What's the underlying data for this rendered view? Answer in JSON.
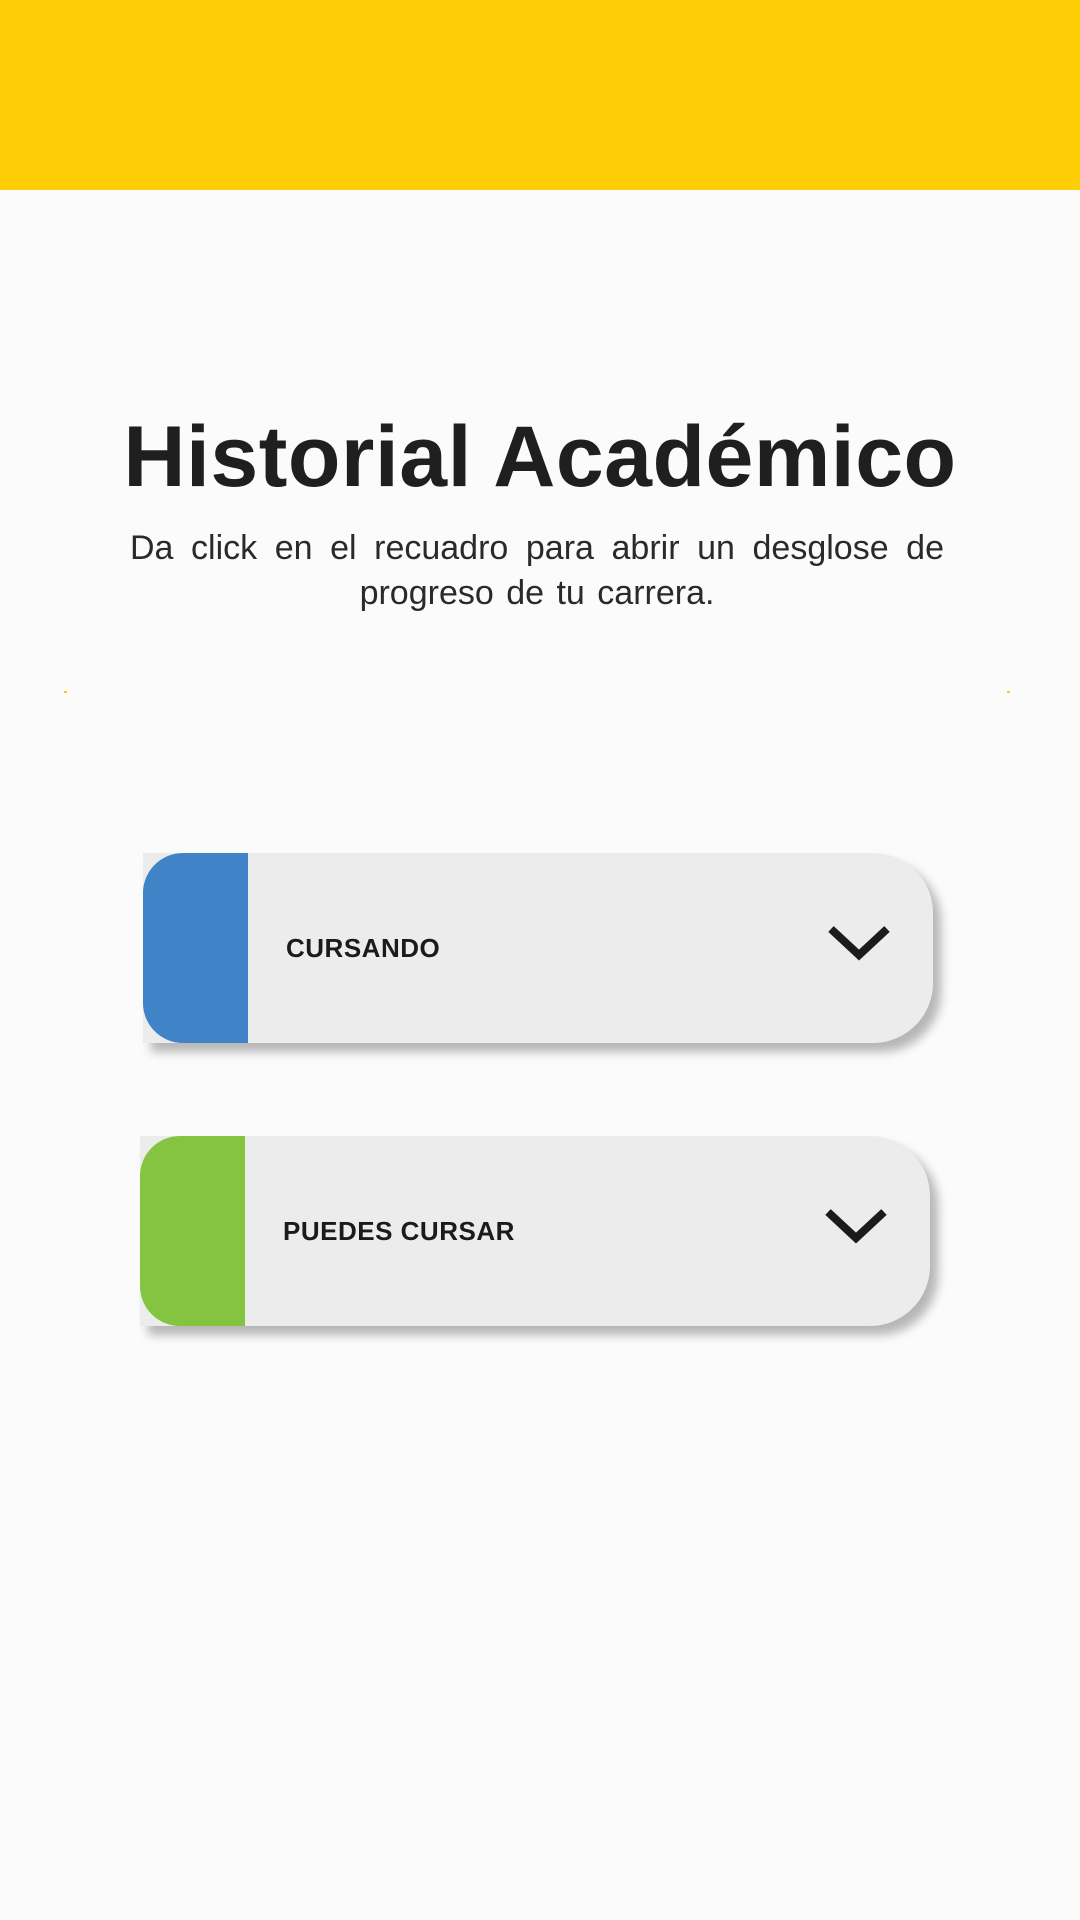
{
  "header": {
    "bar_color": "#fdcd06"
  },
  "main": {
    "title": "Historial Académico",
    "subtitle": "Da click en el recuadro para abrir un desglose de progreso de tu carrera."
  },
  "cards": [
    {
      "label": "CURSANDO",
      "accent_color": "#4083c7",
      "icon": "chevron-down-icon"
    },
    {
      "label": "PUEDES CURSAR",
      "accent_color": "#84c440",
      "icon": "chevron-down-icon"
    }
  ]
}
